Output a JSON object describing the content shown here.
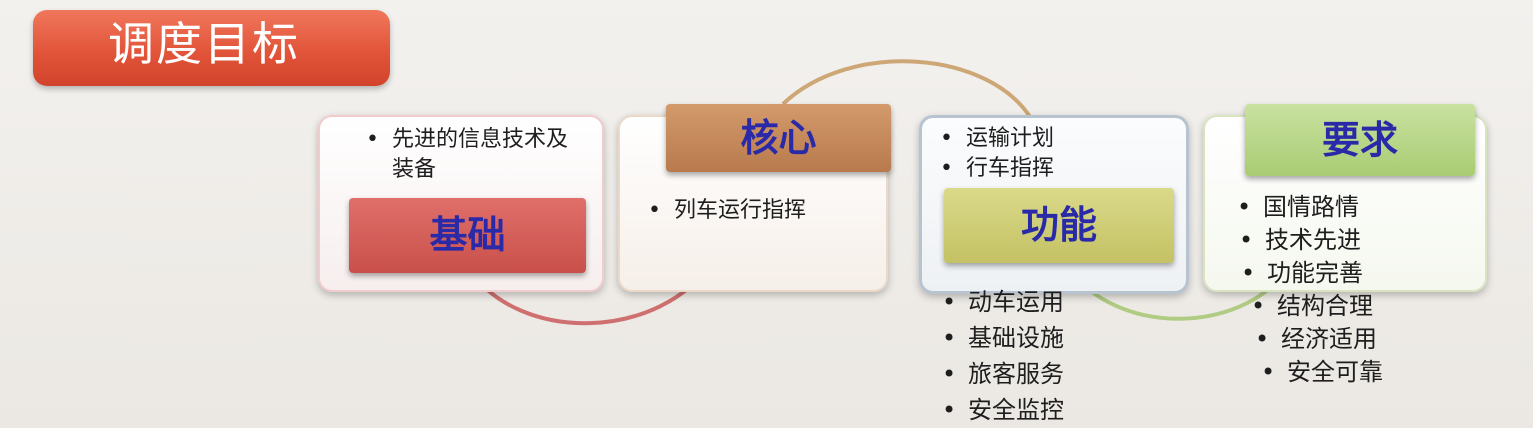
{
  "title": "调度目标",
  "cards": [
    {
      "label": "基础",
      "items": [
        "先进的信息技术及装备"
      ]
    },
    {
      "label": "核心",
      "items": [
        "列车运行指挥"
      ]
    },
    {
      "label": "功能",
      "items_top": [
        "运输计划",
        "行车指挥"
      ],
      "items_bottom": [
        "动车运用",
        "基础设施",
        "旅客服务",
        "安全监控"
      ]
    },
    {
      "label": "要求",
      "items": [
        "国情路情",
        "技术先进",
        "功能完善",
        "结构合理",
        "经济适用",
        "安全可靠"
      ]
    }
  ],
  "colors": {
    "title_bg": "#e2553a",
    "label_jichu": "#c9504a",
    "label_hexin": "#b87a4d",
    "label_gongneng": "#c4c264",
    "label_yaoqiu": "#a9cc74",
    "label_text": "#2a2aa8",
    "arc_red": "#c95a5a",
    "arc_tan": "#c79a62",
    "arc_green": "#a8c878"
  }
}
